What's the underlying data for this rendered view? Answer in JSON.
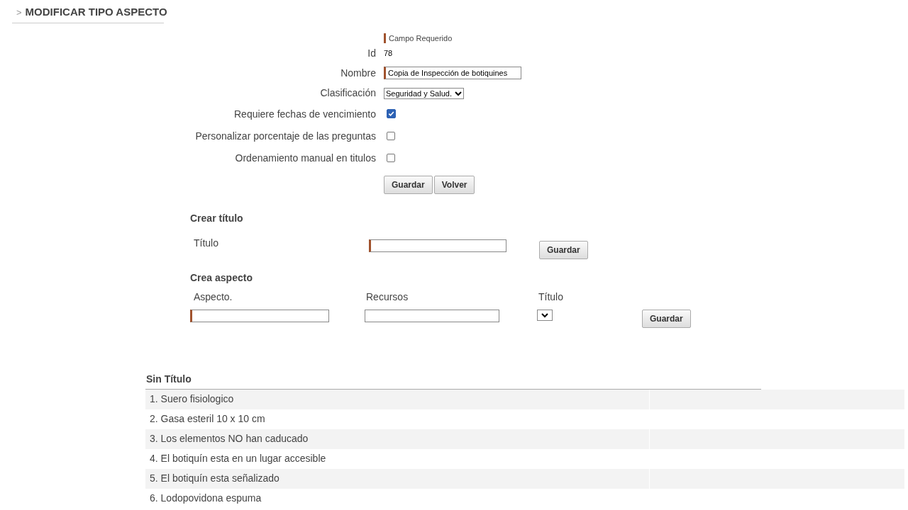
{
  "header": {
    "marker": ">",
    "title": "MODIFICAR TIPO ASPECTO"
  },
  "form": {
    "required_legend": "Campo Requerido",
    "id": {
      "label": "Id",
      "value": "78"
    },
    "nombre": {
      "label": "Nombre",
      "value": "Copia de Inspección de botiquines"
    },
    "clasificacion": {
      "label": "Clasificación",
      "value": "Seguridad y Salud."
    },
    "options": [
      {
        "label": "Requiere fechas de vencimiento",
        "checked": true
      },
      {
        "label": "Personalizar porcentaje de las preguntas",
        "checked": false
      },
      {
        "label": "Ordenamiento manual en titulos",
        "checked": false
      }
    ],
    "buttons": [
      "Guardar",
      "Volver"
    ]
  },
  "crear_titulo": {
    "heading": "Crear título",
    "label": "Título",
    "button": "Guardar"
  },
  "crea_aspecto": {
    "heading": "Crea aspecto",
    "labels": [
      "Aspecto.",
      "Recursos",
      "Título"
    ],
    "button": "Guardar"
  },
  "list": {
    "title": "Sin Título",
    "items": [
      "1. Suero fisiologico",
      "2. Gasa esteril 10 x 10 cm",
      "3. Los elementos NO han caducado",
      "4. El botiquín esta en un lugar accesible",
      "5. El botiquín esta señalizado",
      "6. Lodopovidona espuma"
    ]
  }
}
